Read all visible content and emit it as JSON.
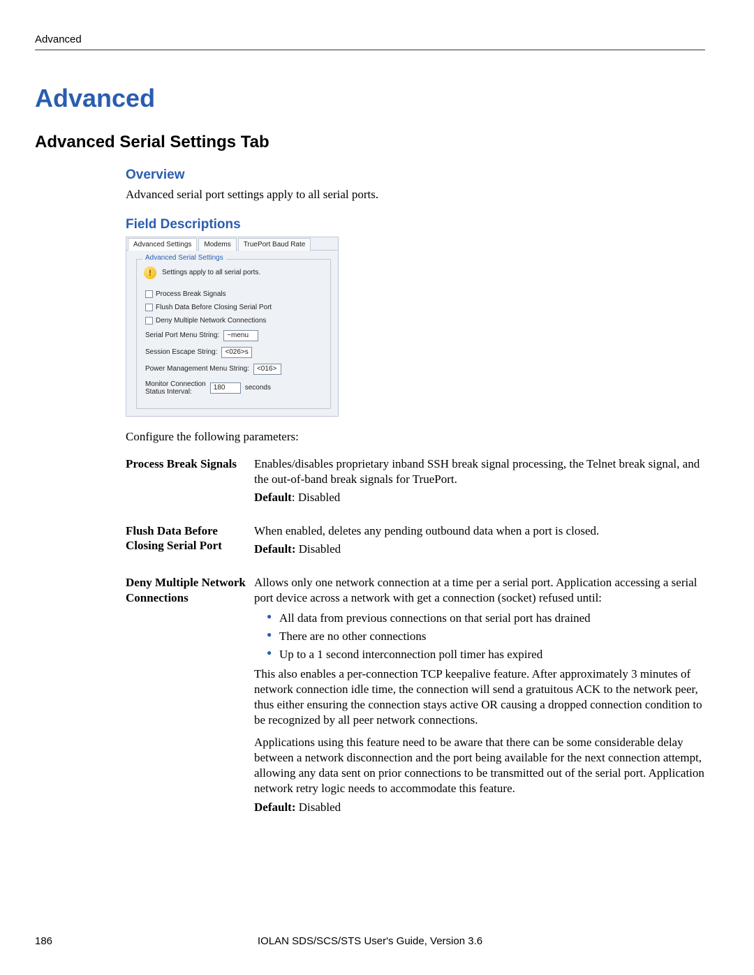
{
  "header": {
    "label": "Advanced"
  },
  "title": "Advanced",
  "section_title": "Advanced Serial Settings Tab",
  "overview": {
    "heading": "Overview",
    "text": "Advanced serial port settings apply to all serial ports."
  },
  "field_desc_heading": "Field Descriptions",
  "screenshot": {
    "tabs": [
      "Advanced Settings",
      "Modems",
      "TruePort Baud Rate"
    ],
    "group_title": "Advanced Serial Settings",
    "hint": "Settings apply to all serial ports.",
    "checks": [
      "Process Break Signals",
      "Flush Data Before Closing Serial Port",
      "Deny Multiple Network Connections"
    ],
    "fields": {
      "menu_string_label": "Serial Port Menu String:",
      "menu_string_value": "~menu",
      "escape_label": "Session Escape String:",
      "escape_value": "<026>s",
      "pm_label": "Power Management Menu String:",
      "pm_value": "<016>",
      "monitor_label1": "Monitor Connection",
      "monitor_label2": "Status Interval:",
      "monitor_value": "180",
      "monitor_unit": "seconds"
    }
  },
  "configure_line": "Configure the following parameters:",
  "params": {
    "pbs": {
      "term": "Process Break Signals",
      "desc": "Enables/disables proprietary inband SSH break signal processing, the Telnet break signal, and the out-of-band break signals for TruePort.",
      "default_label": "Default",
      "default_sep": ": ",
      "default_value": "Disabled"
    },
    "flush": {
      "term": "Flush Data Before Closing Serial Port",
      "desc": "When enabled, deletes any pending outbound data when a port is closed.",
      "default_label": "Default:",
      "default_value": "Disabled"
    },
    "deny": {
      "term": "Deny Multiple Network Connections",
      "desc1": "Allows only one network connection at a time per a serial port. Application accessing a serial port device across a network with get a connection (socket) refused until:",
      "bullets": [
        "All data from previous connections on that serial port has drained",
        "There are no other connections",
        "Up to a 1 second interconnection poll timer has expired"
      ],
      "desc2": "This also enables a per-connection TCP keepalive feature. After approximately 3 minutes of network connection idle time, the connection will send a gratuitous ACK to the network peer, thus either ensuring the connection stays active OR causing a dropped connection condition to be recognized by all peer network connections.",
      "desc3": "Applications using this feature need to be aware that there can be some considerable delay between a network disconnection and the port being available for the next connection attempt, allowing any data sent on prior connections to be transmitted out of the serial port. Application network retry logic needs to accommodate this feature.",
      "default_label": "Default:",
      "default_value": "Disabled"
    }
  },
  "footer": {
    "page": "186",
    "guide": "IOLAN SDS/SCS/STS User's Guide, Version 3.6"
  }
}
